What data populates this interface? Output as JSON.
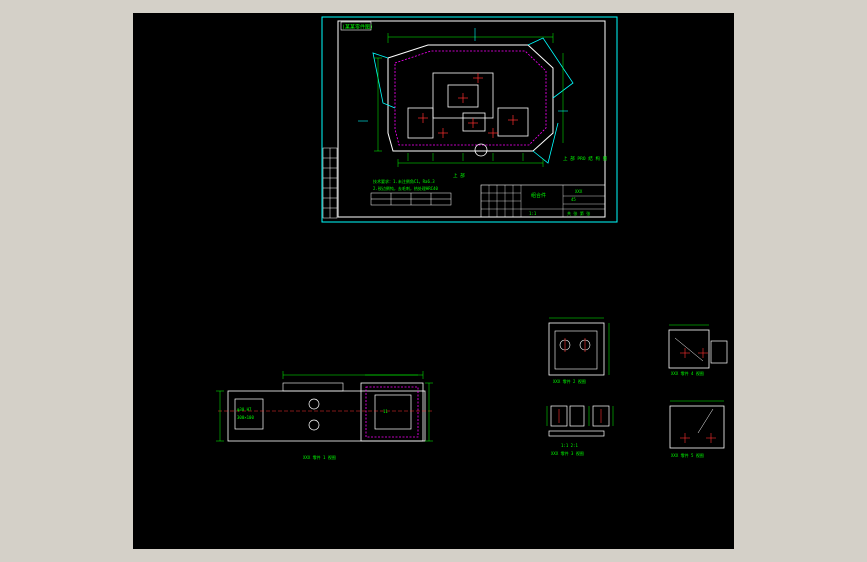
{
  "colors": {
    "background": "#000000",
    "frame": "#d4d0c8",
    "cyan": "#00ffff",
    "white": "#ffffff",
    "green": "#00ff00",
    "red": "#ff3030",
    "magenta": "#ff00ff",
    "yellow": "#ffff00"
  },
  "sheet": {
    "corner_tag": "(某某零件图)",
    "note_right": "上 部 PRO 结 构 图",
    "note_upper": "上 部",
    "tech_note_1": "技术要求：1.未注倒角C1，Ra6.3",
    "tech_note_2": "2.锐边倒钝，去毛刺，热处理HRC40",
    "title_block": {
      "title": "组合件",
      "code": "XXX",
      "material": "45",
      "scale": "1:1",
      "sheet": "共 张 第 张"
    }
  },
  "views": {
    "long_view_caption": "XXX 零件 1 视图",
    "long_view_label_a": "φ30 H7",
    "long_view_label_b": "300×100",
    "long_view_label_c": "11",
    "small_top_caption": "XXX 零件 2 视图",
    "small_bottom_caption": "XXX 零件 3 视图",
    "right_top_caption": "XXX 零件 4 视图",
    "right_bottom_caption": "XXX 零件 5 视图",
    "pair_label": "1:1 2:1"
  }
}
